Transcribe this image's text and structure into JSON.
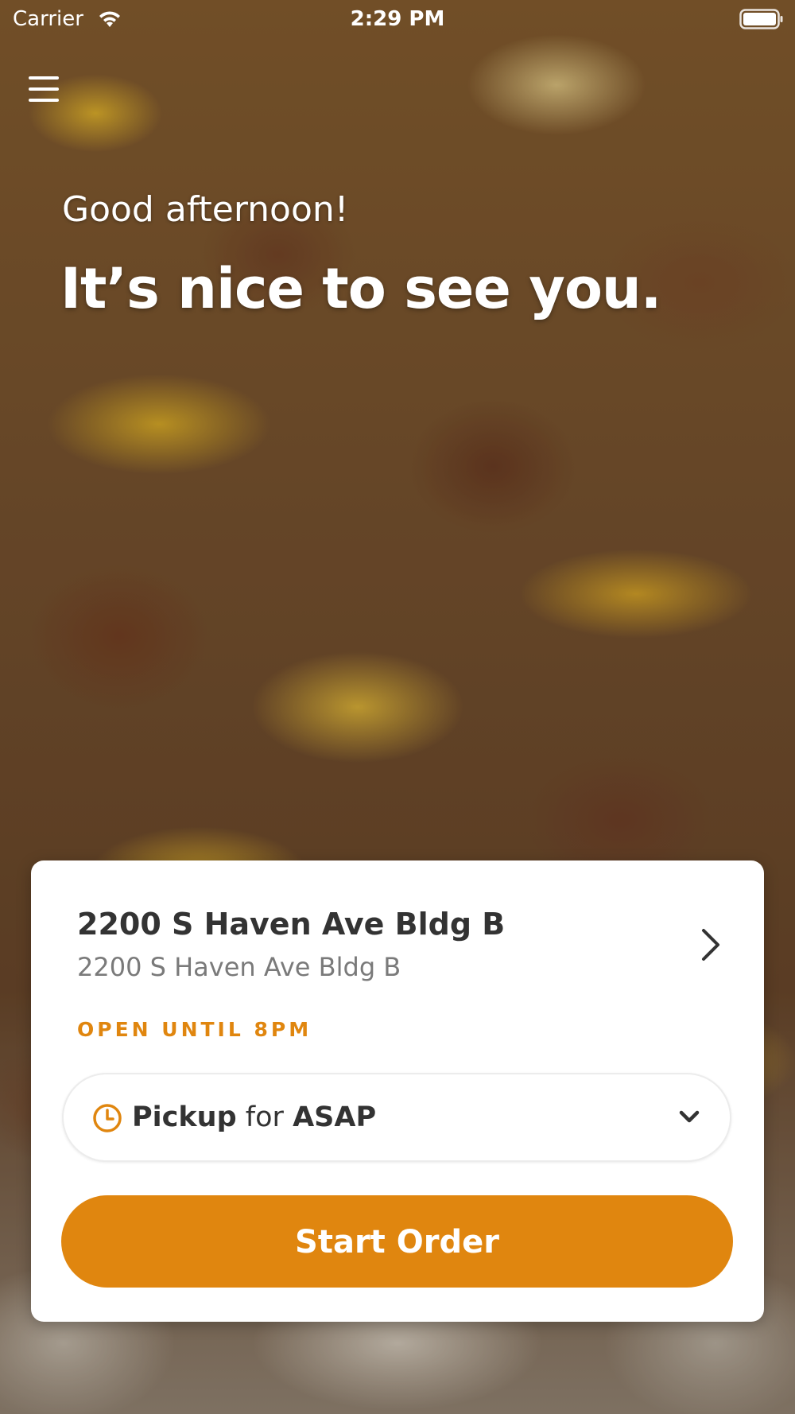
{
  "status_bar": {
    "carrier": "Carrier",
    "time": "2:29 PM",
    "icons": [
      "wifi-icon",
      "battery-icon"
    ]
  },
  "header": {
    "menu_icon": "hamburger-menu-icon",
    "greeting": "Good afternoon!",
    "headline": "It’s nice to see you."
  },
  "location_card": {
    "name": "2200 S Haven Ave Bldg B",
    "address": "2200 S Haven Ave Bldg B",
    "hours": "OPEN UNTIL 8PM",
    "pickup": {
      "mode": "Pickup",
      "connector": "for",
      "time": "ASAP"
    },
    "start_order_label": "Start Order"
  },
  "colors": {
    "accent": "#e0860f",
    "card_background": "#ffffff",
    "primary_text": "#333333",
    "secondary_text": "#7a7a7a"
  }
}
